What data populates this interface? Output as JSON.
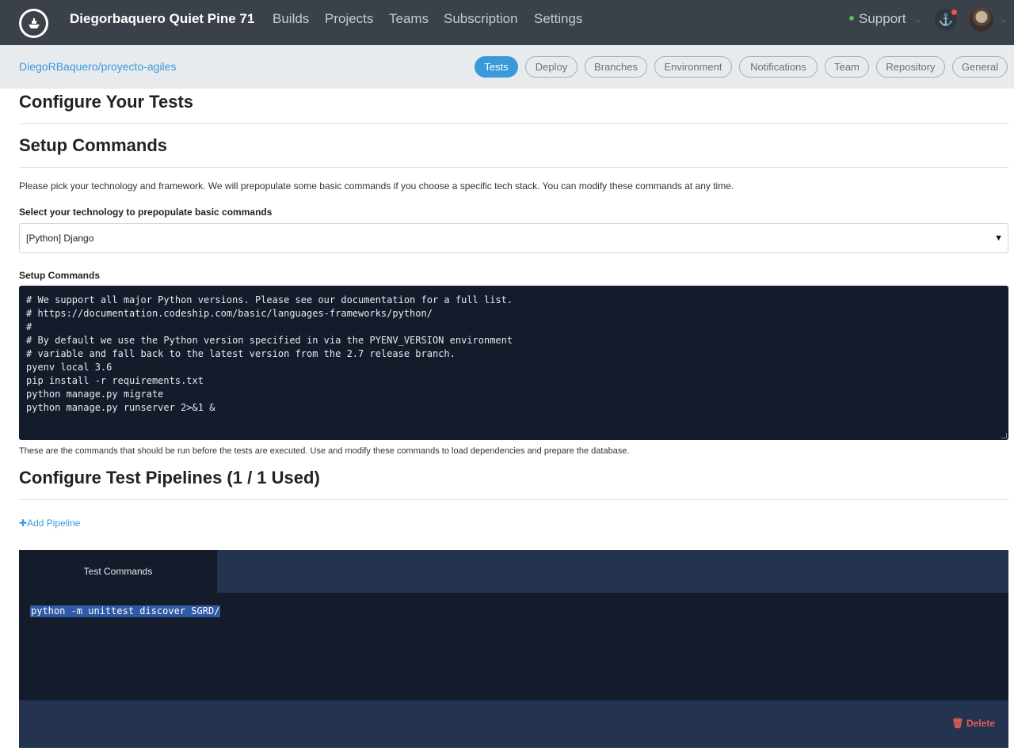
{
  "topnav": {
    "org_name": "Diegorbaquero Quiet Pine 71",
    "links": [
      "Builds",
      "Projects",
      "Teams",
      "Subscription",
      "Settings"
    ],
    "support_label": "Support",
    "icons": {
      "logo": "codeship-logo-icon",
      "anchor": "anchor-icon",
      "chevron": "chevron-down-icon"
    }
  },
  "subbar": {
    "repo": "DiegoRBaquero/proyecto-agiles",
    "tabs": [
      "Tests",
      "Deploy",
      "Branches",
      "Environment",
      "Notifications",
      "Team",
      "Repository",
      "General"
    ],
    "active_tab": "Tests"
  },
  "page": {
    "title": "Configure Your Tests",
    "setup_heading": "Setup Commands",
    "intro": "Please pick your technology and framework. We will prepopulate some basic commands if you choose a specific tech stack. You can modify these commands at any time.",
    "select_label": "Select your technology to prepopulate basic commands",
    "select_value": "[Python] Django",
    "setup_label": "Setup Commands",
    "setup_commands": [
      "# We support all major Python versions. Please see our documentation for a full list.",
      "# https://documentation.codeship.com/basic/languages-frameworks/python/",
      "#",
      "# By default we use the Python version specified in via the PYENV_VERSION environment",
      "# variable and fall back to the latest version from the 2.7 release branch.",
      "pyenv local 3.6",
      "pip install -r requirements.txt",
      "python manage.py migrate",
      "python manage.py runserver 2>&1 &"
    ],
    "setup_help": "These are the commands that should be run before the tests are executed. Use and modify these commands to load dependencies and prepare the database.",
    "pipelines_heading": "Configure Test Pipelines (1 / 1 Used)",
    "add_pipeline": "Add Pipeline",
    "pipeline": {
      "tab_label": "Test Commands",
      "command": "python -m unittest discover SGRD/",
      "delete_label": "Delete"
    }
  },
  "colors": {
    "nav_bg": "#3b4148",
    "subbar_bg": "#e8ebee",
    "accent": "#3a9ad9",
    "code_bg": "#141b2a",
    "pipeline_bar": "#243450",
    "danger": "#e35d55"
  }
}
